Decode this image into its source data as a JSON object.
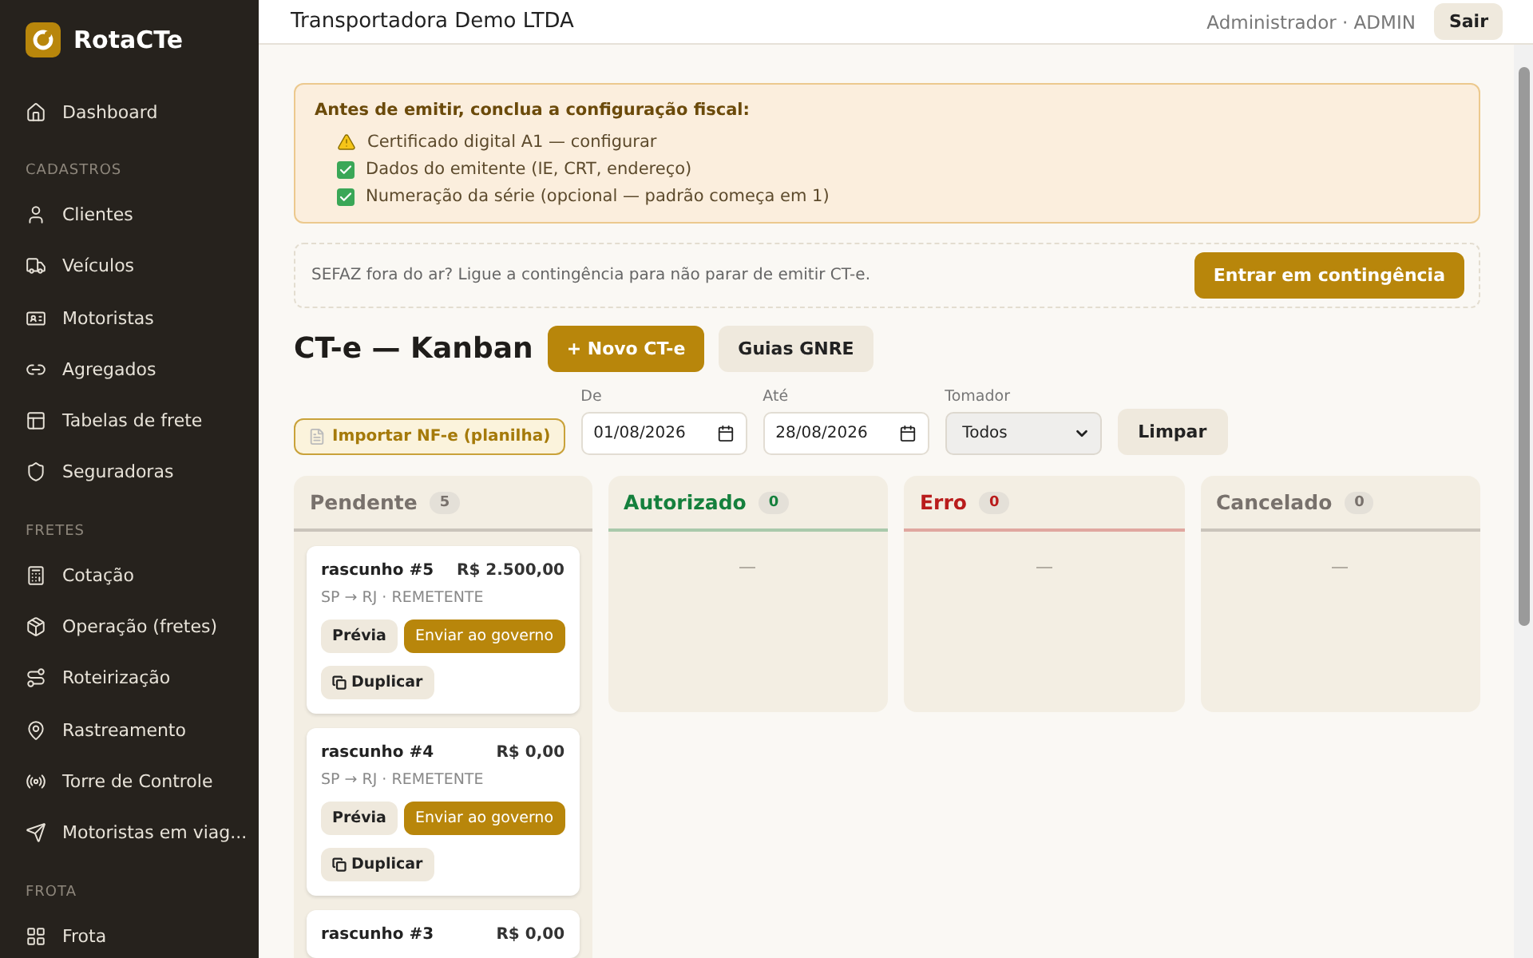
{
  "sidebar": {
    "brand": "RotaCTe",
    "sections": [
      {
        "items": [
          {
            "label": "Dashboard",
            "selected": false
          }
        ]
      },
      {
        "title": "CADASTROS",
        "items": [
          {
            "label": "Clientes",
            "selected": false
          },
          {
            "label": "Veículos",
            "selected": false
          },
          {
            "label": "Motoristas",
            "selected": false
          },
          {
            "label": "Agregados",
            "selected": false
          },
          {
            "label": "Tabelas de frete",
            "selected": false
          },
          {
            "label": "Seguradoras",
            "selected": false
          }
        ]
      },
      {
        "title": "FRETES",
        "items": [
          {
            "label": "Cotação",
            "selected": false
          },
          {
            "label": "Operação (fretes)",
            "selected": false
          },
          {
            "label": "Roteirização",
            "selected": false
          },
          {
            "label": "Rastreamento",
            "selected": false
          },
          {
            "label": "Torre de Controle",
            "selected": false
          },
          {
            "label": "Motoristas em viag...",
            "selected": false
          }
        ]
      },
      {
        "title": "FROTA",
        "items": [
          {
            "label": "Frota",
            "selected": false
          }
        ]
      }
    ]
  },
  "header": {
    "company": "Transportadora Demo LTDA",
    "user": "Administrador · ADMIN",
    "logout": "Sair"
  },
  "setup_notice": {
    "title": "Antes de emitir, conclua a configuração fiscal:",
    "items": [
      {
        "kind": "warning",
        "text": "Certificado digital A1 — configurar"
      },
      {
        "kind": "done",
        "text": "Dados do emitente (IE, CRT, endereço)"
      },
      {
        "kind": "done",
        "text": "Numeração da série (opcional — padrão começa em 1)"
      }
    ]
  },
  "contingency": {
    "text": "SEFAZ fora do ar? Ligue a contingência para não parar de emitir CT-e.",
    "button": "Entrar em contingência"
  },
  "toolbar": {
    "title": "CT-e — Kanban",
    "new_button": "+ Novo CT-e",
    "gnre_button": "Guias GNRE"
  },
  "filters": {
    "import_button": "Importar NF-e (planilha)",
    "from": {
      "label": "De",
      "value": "01/08/2026"
    },
    "to": {
      "label": "Até",
      "value": "28/08/2026"
    },
    "payer": {
      "label": "Tomador",
      "value": "Todos"
    },
    "clear_button": "Limpar"
  },
  "columns": [
    {
      "title": "Pendente",
      "count": "5",
      "color": "#78716c",
      "cards": [
        {
          "title": "rascunho #5",
          "amount": "R$ 2.500,00",
          "route": "SP → RJ · REMETENTE",
          "actions": [
            "Prévia",
            "Enviar ao governo"
          ],
          "duplicate": "Duplicar"
        },
        {
          "title": "rascunho #4",
          "amount": "R$ 0,00",
          "route": "SP → RJ · REMETENTE",
          "actions": [
            "Prévia",
            "Enviar ao governo"
          ],
          "duplicate": "Duplicar"
        },
        {
          "title": "rascunho #3",
          "amount": "R$ 0,00"
        }
      ]
    },
    {
      "title": "Autorizado",
      "count": "0",
      "color": "#15803d"
    },
    {
      "title": "Erro",
      "count": "0",
      "color": "#b91c1c"
    },
    {
      "title": "Cancelado",
      "count": "0",
      "color": "#78716c"
    }
  ]
}
